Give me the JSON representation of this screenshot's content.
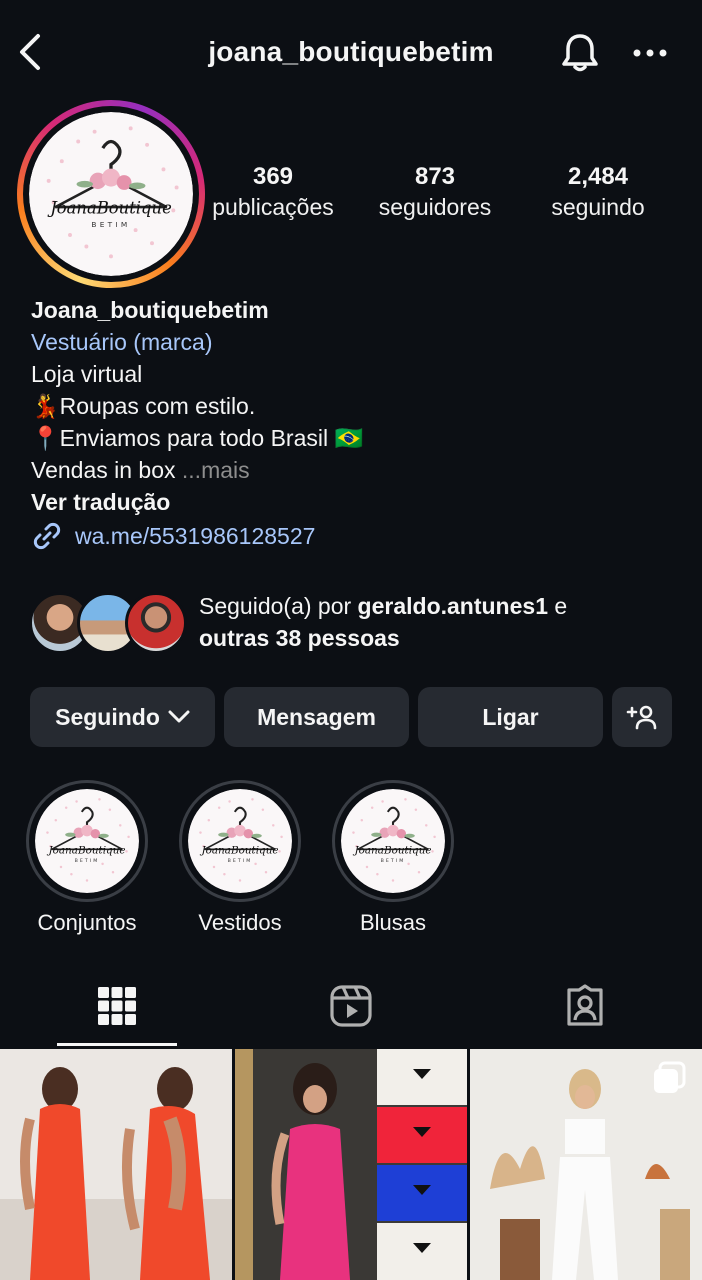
{
  "header": {
    "title": "joana_boutiquebetim",
    "back_icon": "chevron-left-icon",
    "bell_icon": "bell-icon",
    "more_icon": "more-horizontal-icon"
  },
  "profile": {
    "logo_text": "JoanaBoutique",
    "logo_subtext": "BETIM",
    "stats": {
      "posts_count": "369",
      "posts_label": "publicações",
      "followers_count": "873",
      "followers_label": "seguidores",
      "following_count": "2,484",
      "following_label": "seguindo"
    }
  },
  "bio": {
    "name": "Joana_boutiquebetim",
    "category": "Vestuário (marca)",
    "line1": "Loja virtual",
    "line2_emoji": "💃",
    "line2": "Roupas com estilo.",
    "line3_emoji": "📍",
    "line3": "Enviamos para todo Brasil",
    "line3_flag": "🇧🇷",
    "line4": "Vendas in box",
    "ellipsis": "...",
    "more": "mais",
    "translate": "Ver tradução",
    "link": "wa.me/5531986128527"
  },
  "followed_by": {
    "prefix": "Seguido(a) por ",
    "user": "geraldo.antunes1",
    "middle": " e",
    "others": "outras 38 pessoas"
  },
  "actions": {
    "following_label": "Seguindo",
    "message_label": "Mensagem",
    "call_label": "Ligar",
    "add_user_icon": "add-user-icon"
  },
  "highlights": [
    {
      "label": "Conjuntos"
    },
    {
      "label": "Vestidos"
    },
    {
      "label": "Blusas"
    }
  ],
  "tabs": {
    "active": "grid",
    "icons": [
      "grid-icon",
      "reels-icon",
      "tagged-icon"
    ]
  },
  "colors": {
    "background": "#0c0f14",
    "button": "#262a31",
    "link": "#a8c7fa",
    "muted": "#8e8e8e"
  }
}
